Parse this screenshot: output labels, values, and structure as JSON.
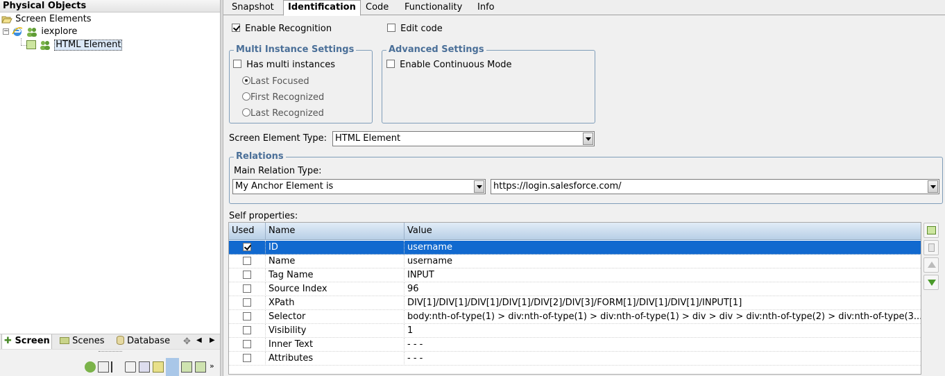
{
  "left_panel": {
    "title": "Physical Objects",
    "tree": {
      "root": "Screen Elements",
      "app": "iexplore",
      "element": "HTML Element"
    },
    "bottom_tabs": [
      {
        "label": "Screen",
        "active": true
      },
      {
        "label": "Scenes",
        "active": false
      },
      {
        "label": "Database",
        "active": false
      }
    ]
  },
  "tabs": [
    {
      "label": "Snapshot",
      "active": false
    },
    {
      "label": "Identification",
      "active": true
    },
    {
      "label": "Code",
      "active": false
    },
    {
      "label": "Functionality",
      "active": false
    },
    {
      "label": "Info",
      "active": false
    }
  ],
  "identification": {
    "enable_recognition": {
      "label": "Enable Recognition",
      "checked": true
    },
    "edit_code": {
      "label": "Edit code",
      "checked": false
    },
    "multi_instance": {
      "legend": "Multi Instance Settings",
      "has_multi": {
        "label": "Has multi instances",
        "checked": false
      },
      "options": [
        {
          "label": "Last Focused",
          "selected": true
        },
        {
          "label": "First Recognized",
          "selected": false
        },
        {
          "label": "Last Recognized",
          "selected": false
        }
      ]
    },
    "advanced": {
      "legend": "Advanced Settings",
      "continuous": {
        "label": "Enable Continuous Mode",
        "checked": false
      }
    },
    "element_type": {
      "label": "Screen Element Type:",
      "value": "HTML Element"
    },
    "relations": {
      "legend": "Relations",
      "main_relation_label": "Main Relation Type:",
      "relation_value": "My Anchor Element is",
      "url_value": "https://login.salesforce.com/"
    },
    "self_properties": {
      "label": "Self properties:",
      "columns": [
        "Used",
        "Name",
        "Value"
      ],
      "rows": [
        {
          "used": true,
          "name": "ID",
          "value": "username",
          "selected": true
        },
        {
          "used": false,
          "name": "Name",
          "value": "username"
        },
        {
          "used": false,
          "name": "Tag Name",
          "value": "INPUT"
        },
        {
          "used": false,
          "name": "Source Index",
          "value": "96"
        },
        {
          "used": false,
          "name": "XPath",
          "value": "DIV[1]/DIV[1]/DIV[1]/DIV[1]/DIV[2]/DIV[3]/FORM[1]/DIV[1]/DIV[1]/INPUT[1]"
        },
        {
          "used": false,
          "name": "Selector",
          "value": "body:nth-of-type(1) > div:nth-of-type(1) > div:nth-of-type(1) > div > div > div:nth-of-type(2) > div:nth-of-type(3..."
        },
        {
          "used": false,
          "name": "Visibility",
          "value": "1"
        },
        {
          "used": false,
          "name": "Inner Text",
          "value": "- - -"
        },
        {
          "used": false,
          "name": "Attributes",
          "value": "- - -"
        }
      ]
    }
  }
}
